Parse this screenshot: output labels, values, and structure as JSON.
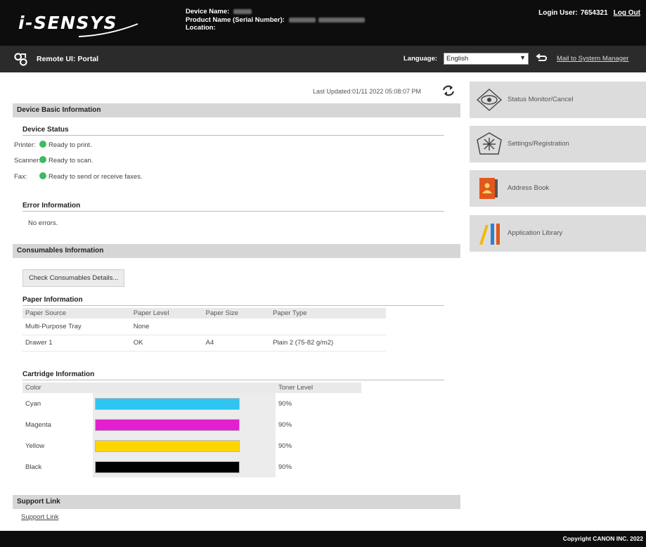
{
  "header": {
    "logo_text": "i-SENSYS",
    "device_name_label": "Device Name:",
    "product_name_label": "Product Name (Serial Number):",
    "location_label": "Location:",
    "login_label": "Login User:",
    "login_user": "7654321",
    "logout_label": "Log Out"
  },
  "portal_bar": {
    "title": "Remote UI: Portal",
    "language_label": "Language:",
    "language_value": "English",
    "mail_link": "Mail to System Manager"
  },
  "main": {
    "last_updated": "Last Updated:01/11 2022 05:08:07 PM",
    "device_basic_information": {
      "heading": "Device Basic Information",
      "device_status": {
        "heading": "Device Status",
        "rows": [
          {
            "label": "Printer:",
            "status": "Ready to print."
          },
          {
            "label": "Scanner:",
            "status": "Ready to scan."
          },
          {
            "label": "Fax:",
            "status": "Ready to send or receive faxes."
          }
        ]
      },
      "error_information": {
        "heading": "Error Information",
        "text": "No errors."
      }
    },
    "consumables": {
      "heading": "Consumables Information",
      "check_button": "Check Consumables Details...",
      "paper": {
        "heading": "Paper Information",
        "columns": [
          "Paper Source",
          "Paper Level",
          "Paper Size",
          "Paper Type"
        ],
        "rows": [
          [
            "Multi-Purpose Tray",
            "None",
            "",
            ""
          ],
          [
            "Drawer 1",
            "OK",
            "A4",
            "Plain 2 (75-82 g/m2)"
          ]
        ]
      },
      "cartridge": {
        "heading": "Cartridge Information",
        "columns": [
          "Color",
          "",
          "Toner Level"
        ],
        "rows": [
          {
            "color": "Cyan",
            "level_text": "90%",
            "level": 1.0,
            "hex": "#2ec5f0"
          },
          {
            "color": "Magenta",
            "level_text": "90%",
            "level": 1.0,
            "hex": "#e31fd0"
          },
          {
            "color": "Yellow",
            "level_text": "90%",
            "level": 1.0,
            "hex": "#ffd500"
          },
          {
            "color": "Black",
            "level_text": "90%",
            "level": 1.0,
            "hex": "#000000"
          }
        ]
      }
    },
    "support": {
      "heading": "Support Link",
      "link": "Support Link"
    }
  },
  "sidebar": {
    "items": [
      {
        "label": "Status Monitor/Cancel",
        "icon": "eye-icon"
      },
      {
        "label": "Settings/Registration",
        "icon": "settings-star-icon"
      },
      {
        "label": "Address Book",
        "icon": "address-book-icon"
      },
      {
        "label": "Application Library",
        "icon": "library-icon"
      }
    ]
  },
  "footer": {
    "copyright": "Copyright CANON INC. 2022"
  }
}
